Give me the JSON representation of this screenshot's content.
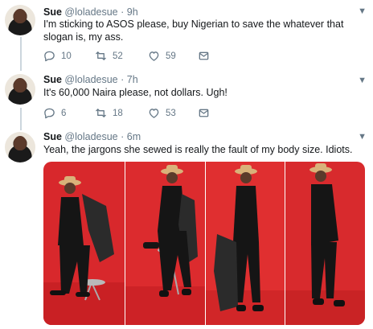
{
  "tweets": [
    {
      "name": "Sue",
      "handle": "@loladesue",
      "time": "· 9h",
      "text": "I'm sticking to ASOS please, buy Nigerian to save the whatever that slogan is, my ass.",
      "replies": "10",
      "retweets": "52",
      "likes": "59"
    },
    {
      "name": "Sue",
      "handle": "@loladesue",
      "time": "· 7h",
      "text": "It's 60,000 Naira please, not dollars. Ugh!",
      "replies": "6",
      "retweets": "18",
      "likes": "53"
    },
    {
      "name": "Sue",
      "handle": "@loladesue",
      "time": "· 6m",
      "text": "Yeah, the jargons she sewed is really the fault of my body size. Idiots."
    }
  ],
  "icons": {
    "reply": "reply-icon",
    "retweet": "retweet-icon",
    "like": "heart-icon",
    "message": "direct-message-icon",
    "more": "chevron-down-icon"
  },
  "colors": {
    "text": "#14171a",
    "secondary": "#657786",
    "thread": "#ccd6dd",
    "photo_bg": "#d8282c"
  }
}
